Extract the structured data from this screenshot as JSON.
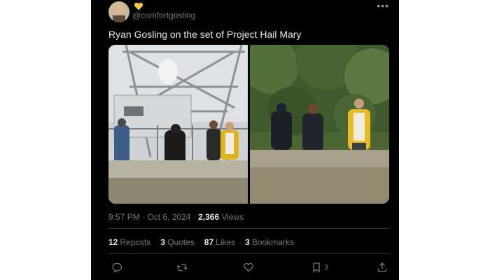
{
  "tweet": {
    "handle": "@comfortgosling",
    "text": "Ryan Gosling on the set of Project Hail Mary",
    "more_icon": "more-horizontal-icon",
    "heart_badge_color": "#f4c542",
    "time": "9:57 PM",
    "date": "Oct 6, 2024",
    "views_count": "2,366",
    "views_label": "Views"
  },
  "engagement": {
    "reposts": {
      "count": "12",
      "label": "Reposts"
    },
    "quotes": {
      "count": "3",
      "label": "Quotes"
    },
    "likes": {
      "count": "87",
      "label": "Likes"
    },
    "bookmarks": {
      "count": "3",
      "label": "Bookmarks"
    }
  },
  "actions": {
    "reply_icon": "reply-icon",
    "repost_icon": "repost-icon",
    "like_icon": "heart-icon",
    "bookmark_icon": "bookmark-icon",
    "bookmark_count": "3",
    "share_icon": "share-icon"
  }
}
